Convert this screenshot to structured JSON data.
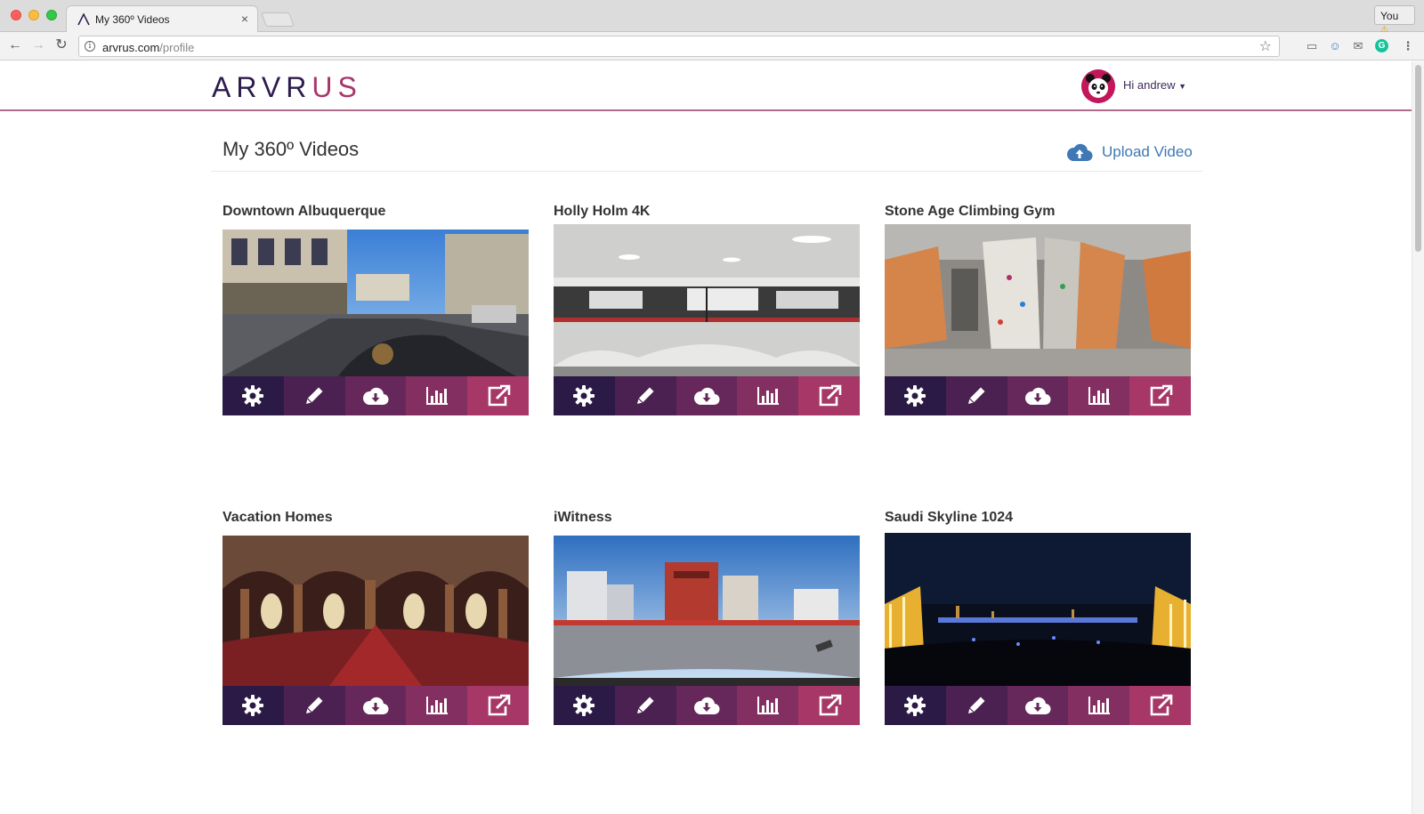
{
  "browser": {
    "tab_title": "My 360º Videos",
    "tab_close": "×",
    "profile_label": "You",
    "url_host": "arvrus.com",
    "url_path": "/profile"
  },
  "site": {
    "logo_part1": "ARVR",
    "logo_part2": "US",
    "greeting": "Hi andrew",
    "accent_colors": [
      "#2b1a45",
      "#4a2150",
      "#66285a",
      "#842f61",
      "#a63767"
    ],
    "link_color": "#3f78b5"
  },
  "page": {
    "title": "My 360º Videos",
    "upload_label": "Upload Video"
  },
  "videos": [
    {
      "title": "Downtown Albuquerque"
    },
    {
      "title": "Holly Holm 4K"
    },
    {
      "title": "Stone Age Climbing Gym"
    },
    {
      "title": "Vacation Homes"
    },
    {
      "title": "iWitness"
    },
    {
      "title": "Saudi Skyline 1024"
    }
  ],
  "actions": [
    "gear-icon",
    "pencil-icon",
    "cloud-download-icon",
    "bar-chart-icon",
    "external-link-icon"
  ]
}
